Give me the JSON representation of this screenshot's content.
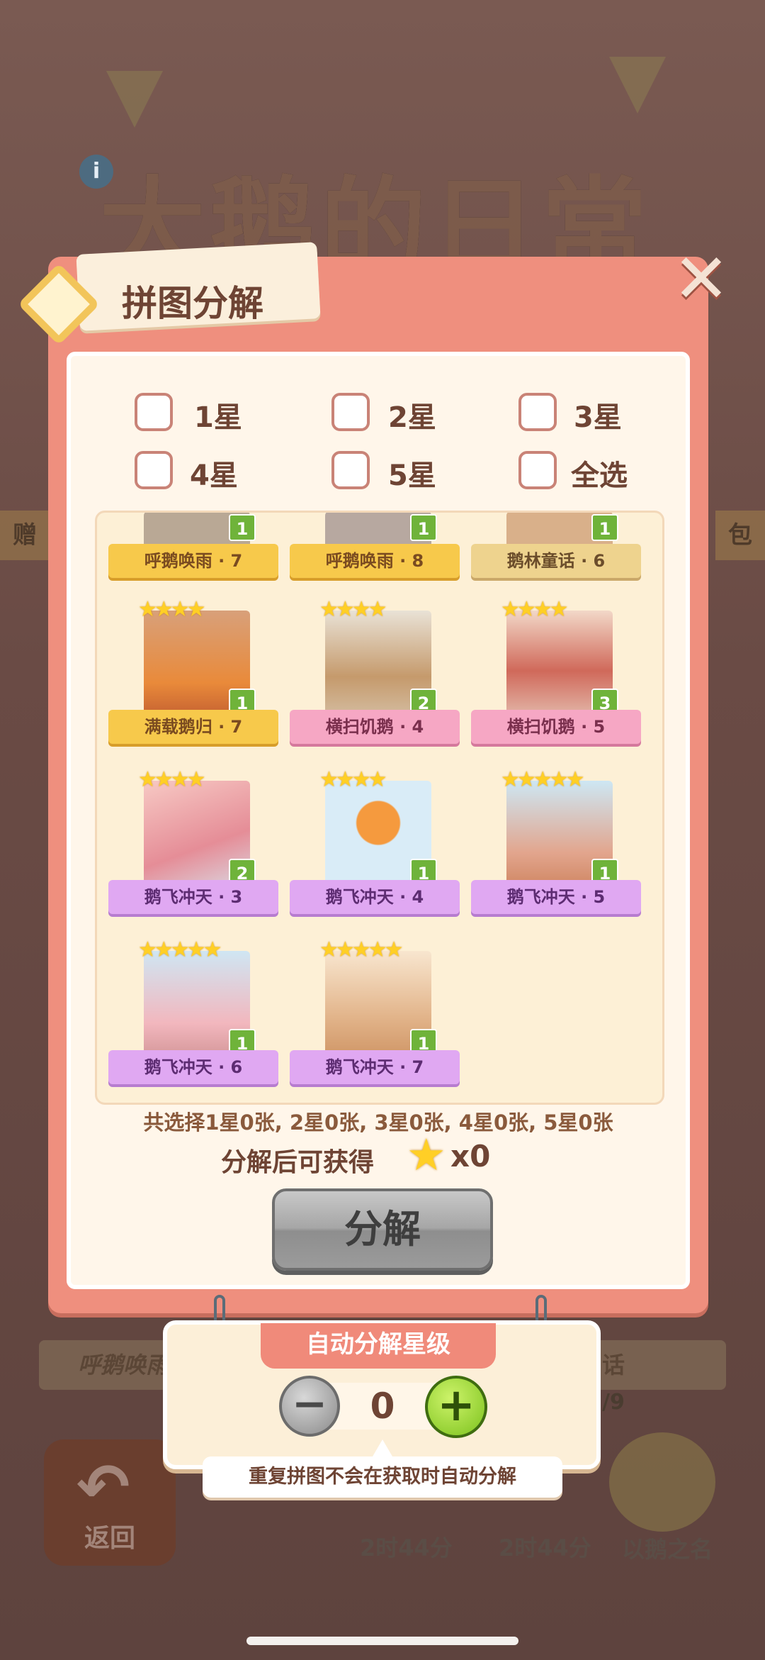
{
  "background": {
    "game_title": "大鹅的日常",
    "info_icon": "i",
    "side_left": "赠",
    "side_right": "包",
    "strip_left": "呼鹅唤雨",
    "strip_right": "话",
    "progress": "/9",
    "return_label": "返回",
    "timer_1": "2时44分",
    "timer_2": "2时44分",
    "goose_name": "以鹅之名"
  },
  "dialog": {
    "title": "拼图分解",
    "close_icon": "close-x-icon",
    "filters": [
      "1星",
      "2星",
      "3星",
      "4星",
      "5星",
      "全选"
    ],
    "cards": [
      {
        "name": "呼鹅唤雨 · 7",
        "stars": 0,
        "count": "1",
        "ribbon": "yellow"
      },
      {
        "name": "呼鹅唤雨 · 8",
        "stars": 0,
        "count": "1",
        "ribbon": "yellow"
      },
      {
        "name": "鹅林童话 · 6",
        "stars": 0,
        "count": "1",
        "ribbon": "tan"
      },
      {
        "name": "满载鹅归 · 7",
        "stars": 4,
        "count": "1",
        "ribbon": "yellow"
      },
      {
        "name": "横扫饥鹅 · 4",
        "stars": 4,
        "count": "2",
        "ribbon": "pink"
      },
      {
        "name": "横扫饥鹅 · 5",
        "stars": 4,
        "count": "3",
        "ribbon": "pink"
      },
      {
        "name": "鹅飞冲天 · 3",
        "stars": 4,
        "count": "2",
        "ribbon": "purple"
      },
      {
        "name": "鹅飞冲天 · 4",
        "stars": 4,
        "count": "1",
        "ribbon": "purple"
      },
      {
        "name": "鹅飞冲天 · 5",
        "stars": 5,
        "count": "1",
        "ribbon": "purple"
      },
      {
        "name": "鹅飞冲天 · 6",
        "stars": 5,
        "count": "1",
        "ribbon": "purple"
      },
      {
        "name": "鹅飞冲天 · 7",
        "stars": 5,
        "count": "1",
        "ribbon": "purple"
      }
    ],
    "summary": "共选择1星0张, 2星0张, 3星0张, 4星0张, 5星0张",
    "gain_label": "分解后可获得",
    "gain_icon": "star-icon",
    "gain_value": "x0",
    "decompose_button": "分解"
  },
  "auto_panel": {
    "title": "自动分解星级",
    "minus": "−",
    "plus": "+",
    "level": "0",
    "note": "重复拼图不会在获取时自动分解"
  },
  "colors": {
    "modal": "#ef8f7e",
    "inner": "#fff6ea",
    "text": "#6e4434",
    "star": "#ffcf26",
    "plus_green": "#7cc21d"
  }
}
